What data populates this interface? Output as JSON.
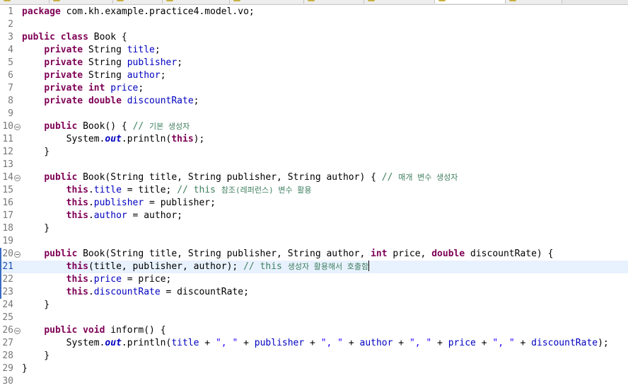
{
  "tabs": [
    {
      "label": "",
      "active": false
    },
    {
      "label": "",
      "active": false
    },
    {
      "label": "",
      "active": false
    },
    {
      "label": "",
      "active": false
    },
    {
      "label": "",
      "active": false
    },
    {
      "label": "",
      "active": false
    },
    {
      "label": "",
      "active": false
    },
    {
      "label": "",
      "active": true
    },
    {
      "label": "",
      "active": false
    }
  ],
  "editor": {
    "language": "java",
    "current_line": 21,
    "caret_after_line_text": true,
    "colors": {
      "keyword": "#7f0055",
      "field": "#0000c0",
      "string": "#2a00ff",
      "comment": "#3f7f5f",
      "line_number": "#787878",
      "current_line_bg": "#e8f2fe"
    },
    "lines": [
      {
        "n": "1",
        "fold": false,
        "tokens": [
          [
            "kw",
            "package"
          ],
          [
            "p",
            " com.kh.example.practice4.model.vo;"
          ]
        ]
      },
      {
        "n": "2",
        "fold": false,
        "tokens": []
      },
      {
        "n": "3",
        "fold": false,
        "tokens": [
          [
            "kw",
            "public"
          ],
          [
            "p",
            " "
          ],
          [
            "kw",
            "class"
          ],
          [
            "p",
            " Book {"
          ]
        ]
      },
      {
        "n": "4",
        "fold": false,
        "tokens": [
          [
            "p",
            "    "
          ],
          [
            "kw",
            "private"
          ],
          [
            "p",
            " String "
          ],
          [
            "fld",
            "title"
          ],
          [
            "p",
            ";"
          ]
        ]
      },
      {
        "n": "5",
        "fold": false,
        "tokens": [
          [
            "p",
            "    "
          ],
          [
            "kw",
            "private"
          ],
          [
            "p",
            " String "
          ],
          [
            "fld",
            "publisher"
          ],
          [
            "p",
            ";"
          ]
        ]
      },
      {
        "n": "6",
        "fold": false,
        "tokens": [
          [
            "p",
            "    "
          ],
          [
            "kw",
            "private"
          ],
          [
            "p",
            " String "
          ],
          [
            "fld",
            "author"
          ],
          [
            "p",
            ";"
          ]
        ]
      },
      {
        "n": "7",
        "fold": false,
        "tokens": [
          [
            "p",
            "    "
          ],
          [
            "kw",
            "private"
          ],
          [
            "p",
            " "
          ],
          [
            "kw",
            "int"
          ],
          [
            "p",
            " "
          ],
          [
            "fld",
            "price"
          ],
          [
            "p",
            ";"
          ]
        ]
      },
      {
        "n": "8",
        "fold": false,
        "tokens": [
          [
            "p",
            "    "
          ],
          [
            "kw",
            "private"
          ],
          [
            "p",
            " "
          ],
          [
            "kw",
            "double"
          ],
          [
            "p",
            " "
          ],
          [
            "fld",
            "discountRate"
          ],
          [
            "p",
            ";"
          ]
        ]
      },
      {
        "n": "9",
        "fold": false,
        "tokens": []
      },
      {
        "n": "10",
        "fold": true,
        "tokens": [
          [
            "p",
            "    "
          ],
          [
            "kw",
            "public"
          ],
          [
            "p",
            " Book() { "
          ],
          [
            "cmt",
            "// "
          ],
          [
            "cmtk",
            "기본 생성자"
          ]
        ]
      },
      {
        "n": "11",
        "fold": false,
        "tokens": [
          [
            "p",
            "        System."
          ],
          [
            "sfld",
            "out"
          ],
          [
            "p",
            ".println("
          ],
          [
            "kw",
            "this"
          ],
          [
            "p",
            ");"
          ]
        ]
      },
      {
        "n": "12",
        "fold": false,
        "tokens": [
          [
            "p",
            "    }"
          ]
        ]
      },
      {
        "n": "13",
        "fold": false,
        "tokens": []
      },
      {
        "n": "14",
        "fold": true,
        "tokens": [
          [
            "p",
            "    "
          ],
          [
            "kw",
            "public"
          ],
          [
            "p",
            " Book(String title, String publisher, String author) { "
          ],
          [
            "cmt",
            "// "
          ],
          [
            "cmtk",
            "매개 변수 생성자"
          ]
        ]
      },
      {
        "n": "15",
        "fold": false,
        "tokens": [
          [
            "p",
            "        "
          ],
          [
            "kw",
            "this"
          ],
          [
            "p",
            "."
          ],
          [
            "fld",
            "title"
          ],
          [
            "p",
            " = title; "
          ],
          [
            "cmt",
            "// this "
          ],
          [
            "cmtk",
            "참조(레퍼런스) 변수 활용"
          ]
        ]
      },
      {
        "n": "16",
        "fold": false,
        "tokens": [
          [
            "p",
            "        "
          ],
          [
            "kw",
            "this"
          ],
          [
            "p",
            "."
          ],
          [
            "fld",
            "publisher"
          ],
          [
            "p",
            " = publisher;"
          ]
        ]
      },
      {
        "n": "17",
        "fold": false,
        "tokens": [
          [
            "p",
            "        "
          ],
          [
            "kw",
            "this"
          ],
          [
            "p",
            "."
          ],
          [
            "fld",
            "author"
          ],
          [
            "p",
            " = author;"
          ]
        ]
      },
      {
        "n": "18",
        "fold": false,
        "tokens": [
          [
            "p",
            "    }"
          ]
        ]
      },
      {
        "n": "19",
        "fold": false,
        "tokens": []
      },
      {
        "n": "20",
        "fold": true,
        "tokens": [
          [
            "p",
            "    "
          ],
          [
            "kw",
            "public"
          ],
          [
            "p",
            " Book(String title, String publisher, String author, "
          ],
          [
            "kw",
            "int"
          ],
          [
            "p",
            " price, "
          ],
          [
            "kw",
            "double"
          ],
          [
            "p",
            " discountRate) {"
          ]
        ]
      },
      {
        "n": "21",
        "fold": false,
        "tokens": [
          [
            "p",
            "        "
          ],
          [
            "kw",
            "this"
          ],
          [
            "p",
            "(title, publisher, author); "
          ],
          [
            "cmt",
            "// this "
          ],
          [
            "cmtk",
            "생성자 활용해서 호출함"
          ]
        ]
      },
      {
        "n": "22",
        "fold": false,
        "tokens": [
          [
            "p",
            "        "
          ],
          [
            "kw",
            "this"
          ],
          [
            "p",
            "."
          ],
          [
            "fld",
            "price"
          ],
          [
            "p",
            " = price;"
          ]
        ]
      },
      {
        "n": "23",
        "fold": false,
        "tokens": [
          [
            "p",
            "        "
          ],
          [
            "kw",
            "this"
          ],
          [
            "p",
            "."
          ],
          [
            "fld",
            "discountRate"
          ],
          [
            "p",
            " = discountRate;"
          ]
        ]
      },
      {
        "n": "24",
        "fold": false,
        "tokens": [
          [
            "p",
            "    }"
          ]
        ]
      },
      {
        "n": "25",
        "fold": false,
        "tokens": []
      },
      {
        "n": "26",
        "fold": true,
        "tokens": [
          [
            "p",
            "    "
          ],
          [
            "kw",
            "public"
          ],
          [
            "p",
            " "
          ],
          [
            "kw",
            "void"
          ],
          [
            "p",
            " inform() {"
          ]
        ]
      },
      {
        "n": "27",
        "fold": false,
        "tokens": [
          [
            "p",
            "        System."
          ],
          [
            "sfld",
            "out"
          ],
          [
            "p",
            ".println("
          ],
          [
            "fld",
            "title"
          ],
          [
            "p",
            " + "
          ],
          [
            "str",
            "\", \""
          ],
          [
            "p",
            " + "
          ],
          [
            "fld",
            "publisher"
          ],
          [
            "p",
            " + "
          ],
          [
            "str",
            "\", \""
          ],
          [
            "p",
            " + "
          ],
          [
            "fld",
            "author"
          ],
          [
            "p",
            " + "
          ],
          [
            "str",
            "\", \""
          ],
          [
            "p",
            " + "
          ],
          [
            "fld",
            "price"
          ],
          [
            "p",
            " + "
          ],
          [
            "str",
            "\", \""
          ],
          [
            "p",
            " + "
          ],
          [
            "fld",
            "discountRate"
          ],
          [
            "p",
            ");"
          ]
        ]
      },
      {
        "n": "28",
        "fold": false,
        "tokens": [
          [
            "p",
            "    }"
          ]
        ]
      },
      {
        "n": "29",
        "fold": false,
        "tokens": [
          [
            "p",
            "}"
          ]
        ]
      },
      {
        "n": "30",
        "fold": false,
        "tokens": []
      }
    ]
  }
}
